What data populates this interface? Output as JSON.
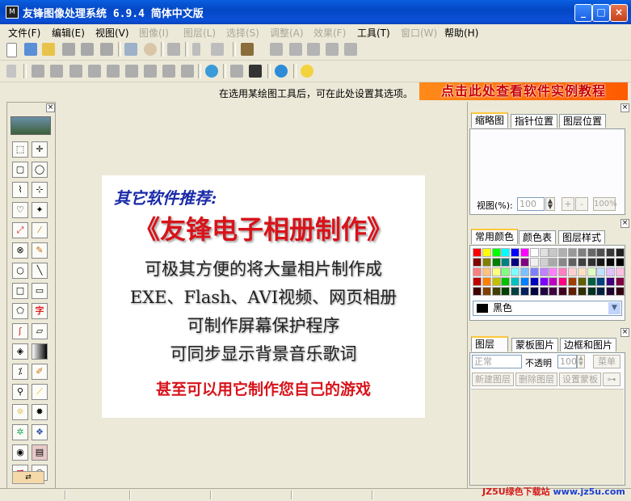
{
  "window": {
    "title": "友锋图像处理系统 6.9.4 简体中文版",
    "minimize": "_",
    "maximize": "□",
    "close": "×"
  },
  "menu": [
    {
      "label": "文件(F)",
      "disabled": false
    },
    {
      "label": "编辑(E)",
      "disabled": false
    },
    {
      "label": "视图(V)",
      "disabled": false
    },
    {
      "label": "图像(I)",
      "disabled": true
    },
    {
      "label": "图层(L)",
      "disabled": true
    },
    {
      "label": "选择(S)",
      "disabled": true
    },
    {
      "label": "调整(A)",
      "disabled": true
    },
    {
      "label": "效果(F)",
      "disabled": true
    },
    {
      "label": "工具(T)",
      "disabled": false
    },
    {
      "label": "窗口(W)",
      "disabled": true
    },
    {
      "label": "帮助(H)",
      "disabled": false
    }
  ],
  "options_bar": {
    "hint": "在选用某绘图工具后，可在此处设置其选项。",
    "promo": "点击此处查看软件实例教程"
  },
  "toolbox": {
    "text_tool_glyph": "字"
  },
  "ad_card": {
    "heading": "其它软件推荐:",
    "product": "《友锋电子相册制作》",
    "line1": "可极其方便的将大量相片制作成",
    "line2": "EXE、Flash、AVI视频、网页相册",
    "line3": "可制作屏幕保护程序",
    "line4": "可同步显示背景音乐歌词",
    "line5": "甚至可以用它制作您自己的游戏"
  },
  "navigator_panel": {
    "tabs": [
      "缩略图",
      "指针位置",
      "图层位置"
    ],
    "zoom_label": "视图(%):",
    "zoom_value": "100",
    "zoom_in": "+",
    "zoom_out": "-",
    "zoom_100": "100%"
  },
  "color_panel": {
    "tabs": [
      "常用颜色",
      "颜色表",
      "图层样式"
    ],
    "selected_color_name": "黑色",
    "selected_color_hex": "#000000"
  },
  "layers_panel": {
    "tabs": [
      "图层",
      "蒙板图片",
      "边框和图片"
    ],
    "blend_mode": "正常",
    "opacity_label": "不透明",
    "opacity_value": "100",
    "menu_button": "菜单",
    "new_layer": "新建图层",
    "delete_layer": "删除图层",
    "set_mask": "设置蒙板"
  },
  "watermark": {
    "brand": "JZ5U绿色下载站",
    "url": "www.jz5u.com"
  }
}
